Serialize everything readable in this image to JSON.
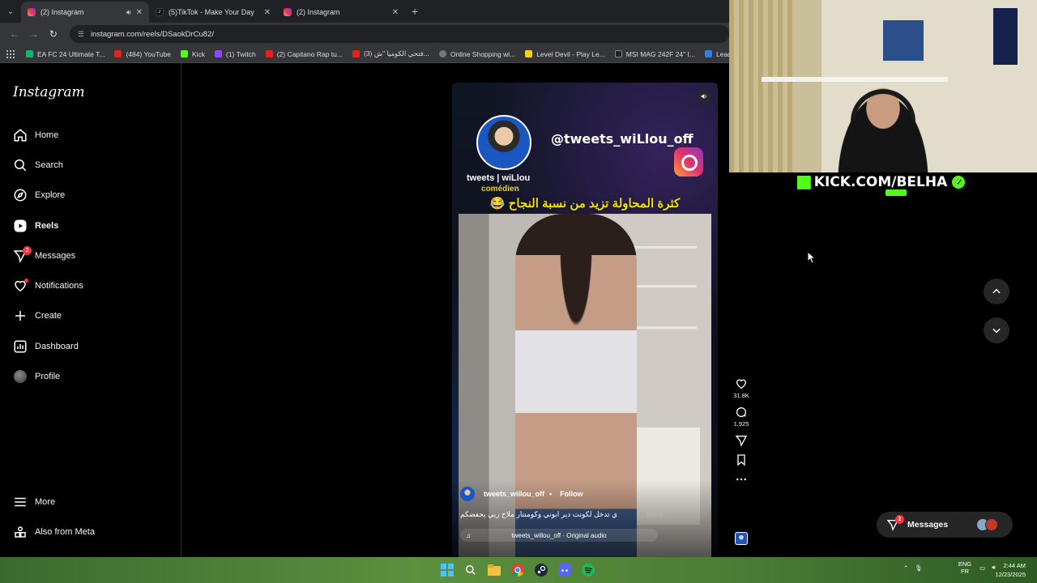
{
  "browser": {
    "tabs": [
      {
        "title": "(2) Instagram",
        "active": true,
        "audio": true
      },
      {
        "title": "(5)TikTok - Make Your Day",
        "active": false
      },
      {
        "title": "(2) Instagram",
        "active": false
      }
    ],
    "url": "instagram.com/reels/DSaokDrCu82/",
    "bookmarks": [
      "EA FC 24 Ultimate T...",
      "(484) YouTube",
      "Kick",
      "(1) Twitch",
      "(2) Capitano Rap tu...",
      "(3) فتحي الكوميا \"ش...",
      "Online Shopping wi...",
      "Level Devil - Play Le...",
      "MSI MAG 242F 24\" I...",
      "Leading Digital"
    ]
  },
  "sidebar": {
    "logo": "Instagram",
    "items": [
      {
        "label": "Home",
        "icon": "home-icon"
      },
      {
        "label": "Search",
        "icon": "search-icon"
      },
      {
        "label": "Explore",
        "icon": "compass-icon"
      },
      {
        "label": "Reels",
        "icon": "reels-icon",
        "active": true
      },
      {
        "label": "Messages",
        "icon": "messenger-icon",
        "badge": "2"
      },
      {
        "label": "Notifications",
        "icon": "heart-icon",
        "dot": true
      },
      {
        "label": "Create",
        "icon": "plus-icon"
      },
      {
        "label": "Dashboard",
        "icon": "dashboard-icon"
      },
      {
        "label": "Profile",
        "icon": "avatar"
      }
    ],
    "bottom": [
      {
        "label": "More",
        "icon": "menu-icon"
      },
      {
        "label": "Also from Meta",
        "icon": "meta-icon"
      }
    ]
  },
  "reel": {
    "handle_overlay": "@tweets_wiLlou_off",
    "creator_name": "tweets | wiLlou",
    "creator_role": "comédien",
    "overlay_text": "كثرة المحاولة تزيد من نسبة النجاح 😂",
    "username": "tweets_willou_off",
    "follow_label": "Follow",
    "caption": "ي تدخل لكونت دير ابوني وكومنتار ملاح ربي يحفضكم",
    "more_label": "... more",
    "audio": "tweets_willou_off · Original audio"
  },
  "actions": {
    "likes": "31.8K",
    "comments": "1,925"
  },
  "messages_pill": {
    "label": "Messages",
    "badge": "2"
  },
  "stream_overlay": {
    "kick_text": "KICK.COM/BELHA"
  },
  "taskbar": {
    "lang_top": "ENG",
    "lang_bottom": "FR",
    "time": "2:44 AM",
    "date": "12/23/2025"
  },
  "colors": {
    "instagram_bg": "#000000",
    "kick_green": "#53fc18",
    "badge_red": "#ff3040",
    "overlay_yellow": "#f3e100"
  }
}
